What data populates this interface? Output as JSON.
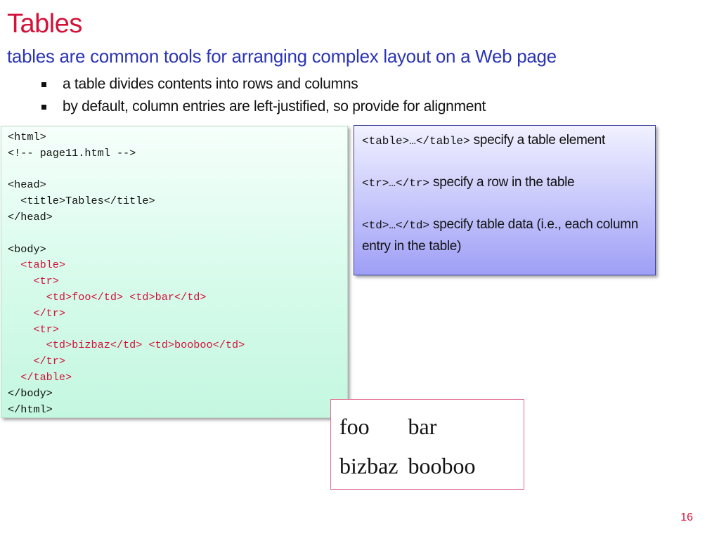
{
  "slide": {
    "title": "Tables",
    "subtitle": "tables are common tools for arranging complex layout on a Web page",
    "bullets": [
      "a table divides contents into rows and columns",
      "by default, column entries are left-justified, so provide for alignment"
    ],
    "page_number": "16"
  },
  "code": {
    "lines": [
      "<html>",
      "<!-- page11.html -->",
      "",
      "<head>",
      "  <title>Tables</title>",
      "</head>",
      "",
      "<body>",
      "  <table>",
      "    <tr>",
      "      <td>foo</td> <td>bar</td>",
      "    </tr>",
      "    <tr>",
      "      <td>bizbaz</td> <td>booboo</td>",
      "    </tr>",
      "  </table>",
      "</body>",
      "</html>"
    ]
  },
  "info": {
    "items": [
      {
        "tag": "<table>…</table>",
        "text": " specify a table element"
      },
      {
        "tag": "<tr>…</tr>",
        "text": " specify a row in the table"
      },
      {
        "tag": "<td>…</td>",
        "text": " specify table data (i.e., each column entry in the table)"
      }
    ]
  },
  "rendered_table": {
    "rows": [
      [
        "foo",
        "bar"
      ],
      [
        "bizbaz",
        "booboo"
      ]
    ]
  },
  "colors": {
    "title": "#d3123a",
    "subtitle": "#2c35b4",
    "code_highlight": "#d3123a"
  }
}
